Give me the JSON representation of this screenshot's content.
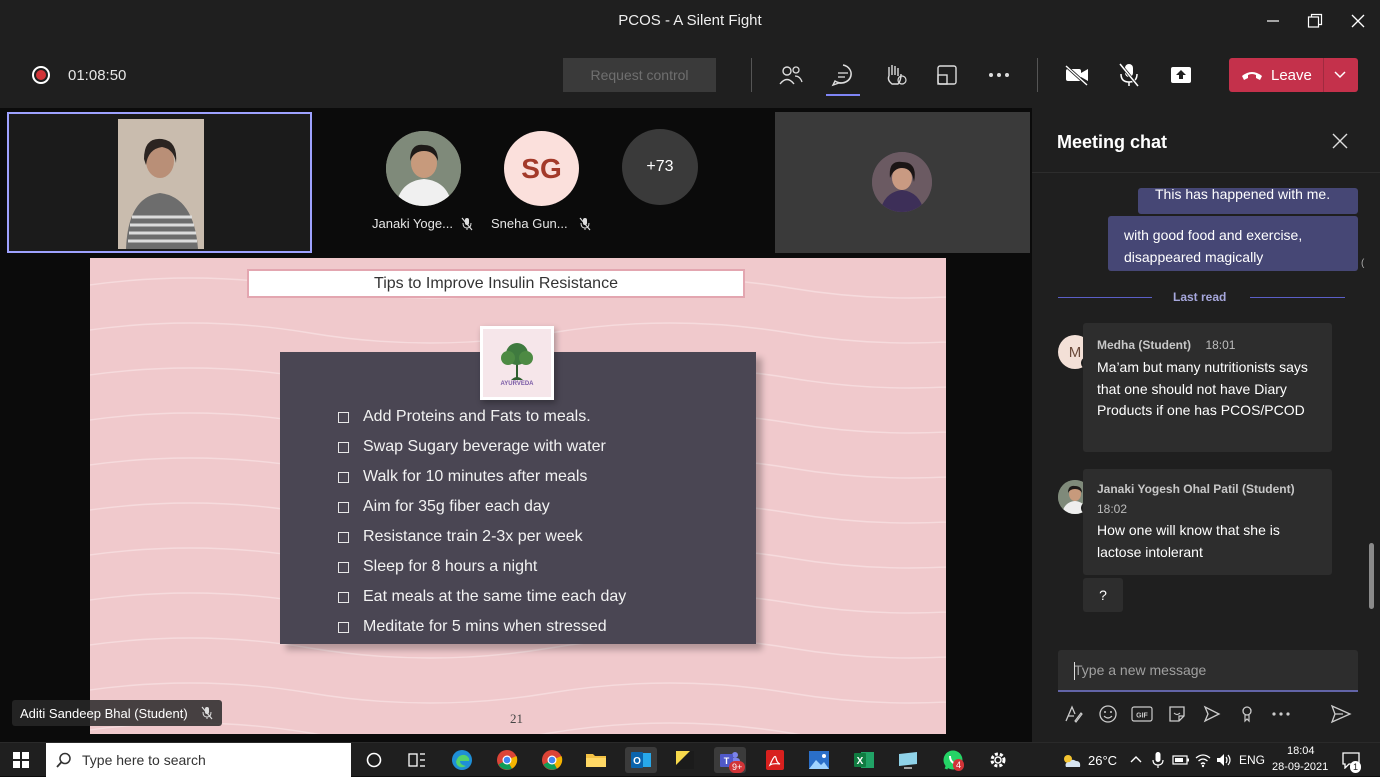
{
  "window": {
    "title": "PCOS - A Silent Fight"
  },
  "controls": {
    "record_time": "01:08:50",
    "request_control": "Request control",
    "leave": "Leave"
  },
  "participants": [
    {
      "name": "Janaki Yoge...",
      "initials": ""
    },
    {
      "name": "Sneha Gun...",
      "initials": "SG"
    }
  ],
  "overflow_count": "+73",
  "presenter": "Aditi Sandeep Bhal (Student)",
  "slide": {
    "title": "Tips to Improve Insulin Resistance",
    "logo_text": "AYURVEDA",
    "bullets": [
      "Add Proteins and Fats to meals.",
      "Swap Sugary beverage with water",
      "Walk for 10 minutes after meals",
      "Aim for 35g fiber each day",
      "Resistance train 2-3x per week",
      "Sleep for 8 hours a night",
      "Eat meals at the same time each day",
      "Meditate for 5 mins when stressed"
    ],
    "page_number": "21"
  },
  "chat": {
    "title": "Meeting chat",
    "self_messages": [
      "This has happened with me.",
      "with good food and exercise, disappeared magically"
    ],
    "last_read": "Last read",
    "messages": [
      {
        "initial": "M",
        "sender": "Medha (Student)",
        "time": "18:01",
        "body": "Ma’am but many nutritionists says that one should not have  Diary Products if one has PCOS/PCOD"
      },
      {
        "initial": "",
        "sender": "Janaki Yogesh Ohal Patil (Student)",
        "time": "18:02",
        "body": "How one will know that she is lactose intolerant",
        "followup": "?"
      }
    ],
    "compose_placeholder": "Type a new message"
  },
  "taskbar": {
    "search_placeholder": "Type here to search",
    "temperature": "26°C",
    "language": "ENG",
    "time": "18:04",
    "date": "28-09-2021",
    "teams_badge": "9+",
    "whatsapp_badge": "4",
    "notification_badge": "1"
  },
  "icons": {
    "controls": [
      "participants-icon",
      "chat-icon",
      "raise-hand-icon",
      "share-tray-icon",
      "more-options-icon",
      "camera-off-icon",
      "mic-off-icon",
      "share-screen-icon"
    ],
    "compose_tools": [
      "format-icon",
      "emoji-icon",
      "gif-icon",
      "sticker-icon",
      "meet-now-icon",
      "praise-icon",
      "more-icon",
      "send-icon"
    ]
  },
  "colors": {
    "accent": "#6264a7",
    "leave": "#c4314b",
    "self_bubble": "#464775",
    "slide_bg": "#f0c9cc",
    "slide_panel": "#4a4653"
  }
}
